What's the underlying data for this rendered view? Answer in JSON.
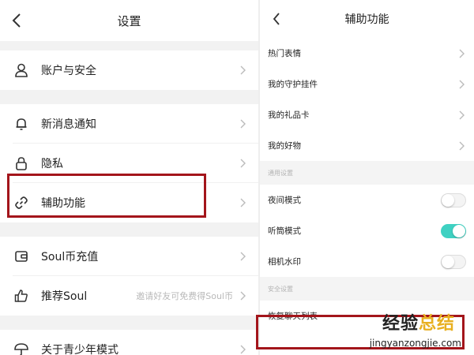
{
  "left": {
    "title": "设置",
    "items": [
      {
        "label": "账户与安全",
        "icon": "person-icon"
      },
      {
        "label": "新消息通知",
        "icon": "bell-icon"
      },
      {
        "label": "隐私",
        "icon": "lock-icon"
      },
      {
        "label": "辅助功能",
        "icon": "link-icon"
      },
      {
        "label": "Soul币充值",
        "icon": "wallet-icon"
      },
      {
        "label": "推荐Soul",
        "icon": "thumbs-up-icon",
        "sub": "邀请好友可免费得Soul币"
      },
      {
        "label": "关于青少年模式",
        "icon": "umbrella-icon"
      }
    ]
  },
  "right": {
    "title": "辅助功能",
    "items": [
      {
        "label": "热门表情"
      },
      {
        "label": "我的守护挂件"
      },
      {
        "label": "我的礼品卡"
      },
      {
        "label": "我的好物"
      }
    ],
    "general_header": "通用设置",
    "toggles": [
      {
        "label": "夜间模式",
        "on": false
      },
      {
        "label": "听筒模式",
        "on": true
      },
      {
        "label": "相机水印",
        "on": false
      }
    ],
    "security_header": "安全设置",
    "restore_label": "恢复聊天列表"
  },
  "watermark": {
    "text_a": "经验",
    "text_b": "总结",
    "url": "jingyanzongjie.com"
  },
  "colors": {
    "highlight": "#a3151b",
    "toggle_on": "#3fd1c2",
    "watermark_accent": "#e8b021"
  }
}
